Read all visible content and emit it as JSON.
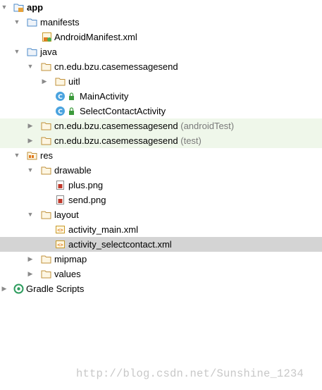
{
  "tree": {
    "app": "app",
    "manifests": "manifests",
    "android_manifest": "AndroidManifest.xml",
    "java": "java",
    "pkg_main": "cn.edu.bzu.casemessagesend",
    "uitl": "uitl",
    "main_activity": "MainActivity",
    "select_contact_activity": "SelectContactActivity",
    "pkg_android_test": "cn.edu.bzu.casemessagesend",
    "pkg_android_test_suffix": "(androidTest)",
    "pkg_test": "cn.edu.bzu.casemessagesend",
    "pkg_test_suffix": "(test)",
    "res": "res",
    "drawable": "drawable",
    "plus_png": "plus.png",
    "send_png": "send.png",
    "layout": "layout",
    "activity_main_xml": "activity_main.xml",
    "activity_selectcontact_xml": "activity_selectcontact.xml",
    "mipmap": "mipmap",
    "values": "values",
    "gradle_scripts": "Gradle Scripts"
  },
  "watermark": "http://blog.csdn.net/Sunshine_1234",
  "colors": {
    "test_row_background": "#eff7ea",
    "selected_row_background": "#d4d4d4",
    "folder_blue": "#4e8bc9",
    "class_icon_blue": "#4aa3df",
    "lock_green": "#3c9a3c",
    "xml_orange": "#e07a1f"
  }
}
